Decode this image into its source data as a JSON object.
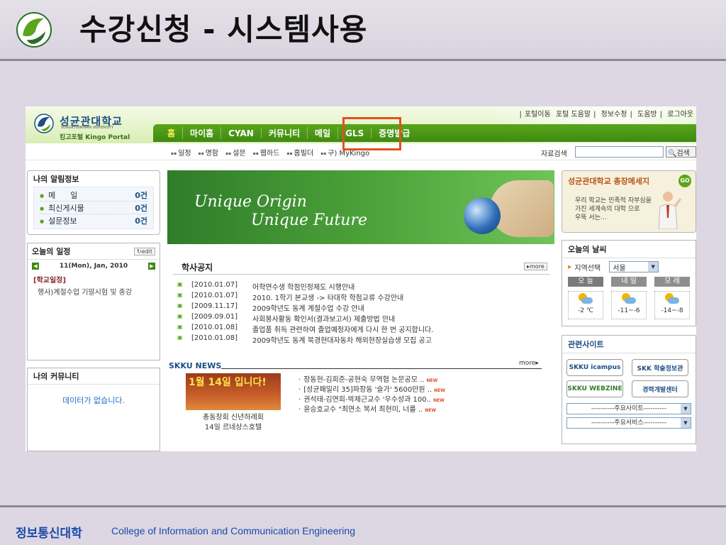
{
  "slide": {
    "title": "수강신청 - 시스템사용",
    "footer_ko": "정보통신대학",
    "footer_en": "College of Information and Communication Engineering"
  },
  "portal": {
    "logo": {
      "univ_ko": "성균관대학교",
      "univ_en": "SUNGKYUNKWAN UNIVERSITY",
      "portal_name": "킹고포털 Kingo Portal"
    },
    "top_links": [
      "포털이동",
      "포털 도움말",
      "정보수정",
      "도움방",
      "로그아웃"
    ],
    "main_nav": [
      "홈",
      "마이홈",
      "CYAN",
      "커뮤니티",
      "메일",
      "GLS",
      "증명발급"
    ],
    "sub_nav": [
      "일정",
      "명함",
      "설문",
      "웹하드",
      "홈빌더",
      "구) MyKingo"
    ],
    "search": {
      "label": "자료검색",
      "value": "",
      "button": "검색"
    },
    "alerts": {
      "title": "나의 알림정보",
      "items": [
        {
          "label": "메      일",
          "count": "0건"
        },
        {
          "label": "최신게시물",
          "count": "0건"
        },
        {
          "label": "설문정보",
          "count": "0건"
        }
      ]
    },
    "schedule": {
      "title": "오늘의 일정",
      "edit": "edit",
      "date": "11(Mon), Jan, 2010",
      "category": "[학교일정]",
      "item": "행사)계절수업 기말시험 및 종강"
    },
    "community": {
      "title": "나의 커뮤니티",
      "empty": "데이터가 없습니다."
    },
    "banner": {
      "line1": "Unique Origin",
      "line2": "Unique Future"
    },
    "notice": {
      "title": "학사공지",
      "more": "more",
      "items": [
        {
          "date": "[2010.01.07]",
          "text": "어학연수생 학점인정제도 시행안내"
        },
        {
          "date": "[2010.01.07]",
          "text": "2010. 1학기 본교생 -> 타대학 학점교류 수강안내"
        },
        {
          "date": "[2009.11.17]",
          "text": "2009학년도 동계 계절수업 수강 안내"
        },
        {
          "date": "[2009.09.01]",
          "text": "사회봉사활동 확인서(결과보고서) 제출방법 안내"
        },
        {
          "date": "[2010.01.08]",
          "text": "졸업품 취득 관련하여 졸업예정자에게 다시 한 번 공지합니다."
        },
        {
          "date": "[2010.01.08]",
          "text": "2009학년도 동계 북경현대자동차 해외현장실습생 모집 공고"
        }
      ]
    },
    "news": {
      "title": "SKKU NEWS",
      "more": "more",
      "image_text": "1월 14일 입니다!",
      "caption_line1": "총동창회 신년하례회",
      "caption_line2": "14일 르네상스호텔",
      "new_label": "NEW",
      "items": [
        "장동현-김희준-공현숙 무역협 논문공모 ..",
        "[성균패밀리 35]파장동 '슬가' 5600만원 ..",
        "권석태-김연희-박제근교수 '우수성과 100..",
        "윤승호교수 \"최연소 복서 최현미, 너를 .."
      ]
    },
    "president": {
      "title": "성균관대학교 총장메세지",
      "go": "GO",
      "msg_line1": "우리 학교는 민족적 자부심을",
      "msg_line2": "가진 세계속의 대학 으로",
      "msg_line3": "우뚝 서는..."
    },
    "weather": {
      "title": "오늘의 날씨",
      "region_label": "지역선택",
      "region_value": "서울",
      "days": [
        "오 늘",
        "내 일",
        "모 레"
      ],
      "temps": [
        "-2 ℃",
        "-11~-6",
        "-14~-8"
      ]
    },
    "related": {
      "title": "관련사이트",
      "sites": [
        "SKKU icampus",
        "SKK 학술정보관",
        "SKKU WEBZINE",
        "경력개발센터"
      ],
      "select1": "----------주요사이트----------",
      "select2": "----------주요서비스----------"
    }
  },
  "colors": {
    "nav_green": "#3f8a10",
    "highlight": "#e3501b",
    "footer_text": "#1a4aa8"
  }
}
